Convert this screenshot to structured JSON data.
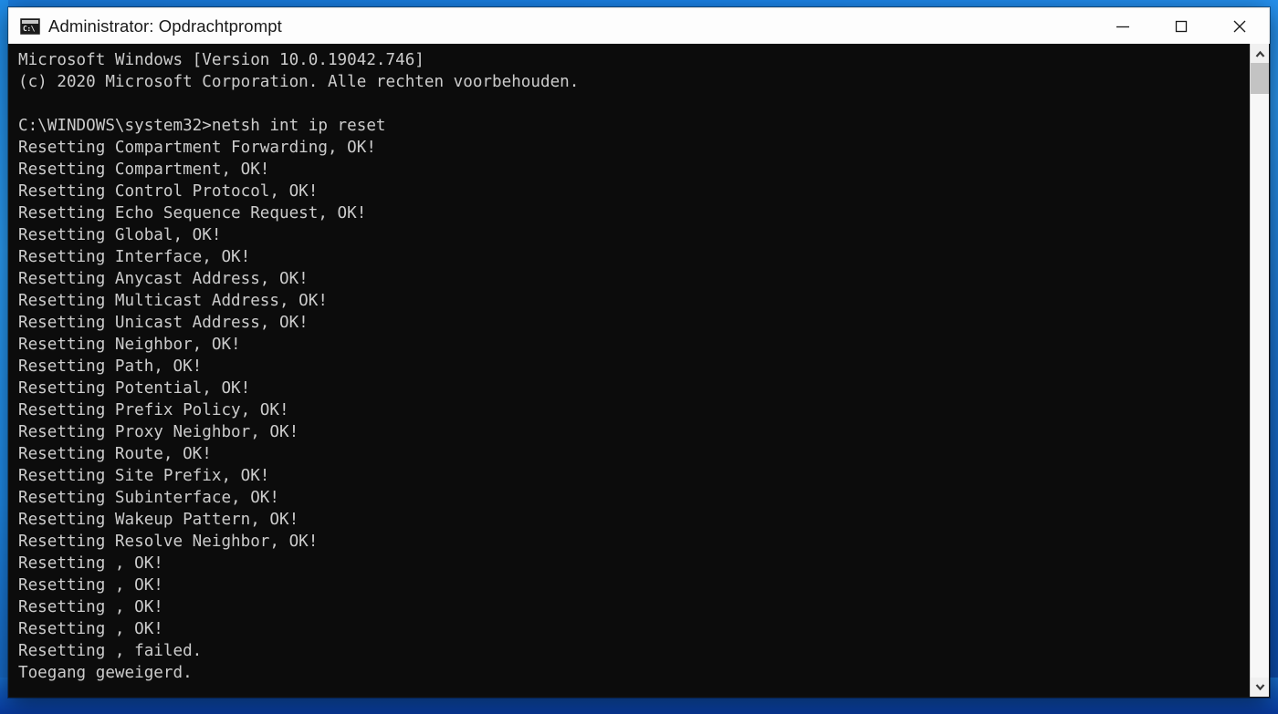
{
  "desktop": {
    "background_color": "#1b84ea"
  },
  "window": {
    "title": "Administrator: Opdrachtprompt",
    "icon_name": "command-prompt-icon",
    "icon_glyph": "C:\\",
    "background_color": "#0c0c0c",
    "text_color": "#cccccc",
    "titlebar_color": "#fdfdfd",
    "controls": {
      "minimize_label": "Minimize",
      "maximize_label": "Maximize",
      "close_label": "Close"
    }
  },
  "console": {
    "prompt_path": "C:\\WINDOWS\\system32>",
    "command": "netsh int ip reset",
    "lines": [
      "Microsoft Windows [Version 10.0.19042.746]",
      "(c) 2020 Microsoft Corporation. Alle rechten voorbehouden.",
      "",
      "C:\\WINDOWS\\system32>netsh int ip reset",
      "Resetting Compartment Forwarding, OK!",
      "Resetting Compartment, OK!",
      "Resetting Control Protocol, OK!",
      "Resetting Echo Sequence Request, OK!",
      "Resetting Global, OK!",
      "Resetting Interface, OK!",
      "Resetting Anycast Address, OK!",
      "Resetting Multicast Address, OK!",
      "Resetting Unicast Address, OK!",
      "Resetting Neighbor, OK!",
      "Resetting Path, OK!",
      "Resetting Potential, OK!",
      "Resetting Prefix Policy, OK!",
      "Resetting Proxy Neighbor, OK!",
      "Resetting Route, OK!",
      "Resetting Site Prefix, OK!",
      "Resetting Subinterface, OK!",
      "Resetting Wakeup Pattern, OK!",
      "Resetting Resolve Neighbor, OK!",
      "Resetting , OK!",
      "Resetting , OK!",
      "Resetting , OK!",
      "Resetting , OK!",
      "Resetting , failed.",
      "Toegang geweigerd."
    ]
  },
  "scrollbar": {
    "up_arrow_name": "scroll-up-arrow",
    "down_arrow_name": "scroll-down-arrow",
    "thumb_name": "scrollbar-thumb"
  }
}
